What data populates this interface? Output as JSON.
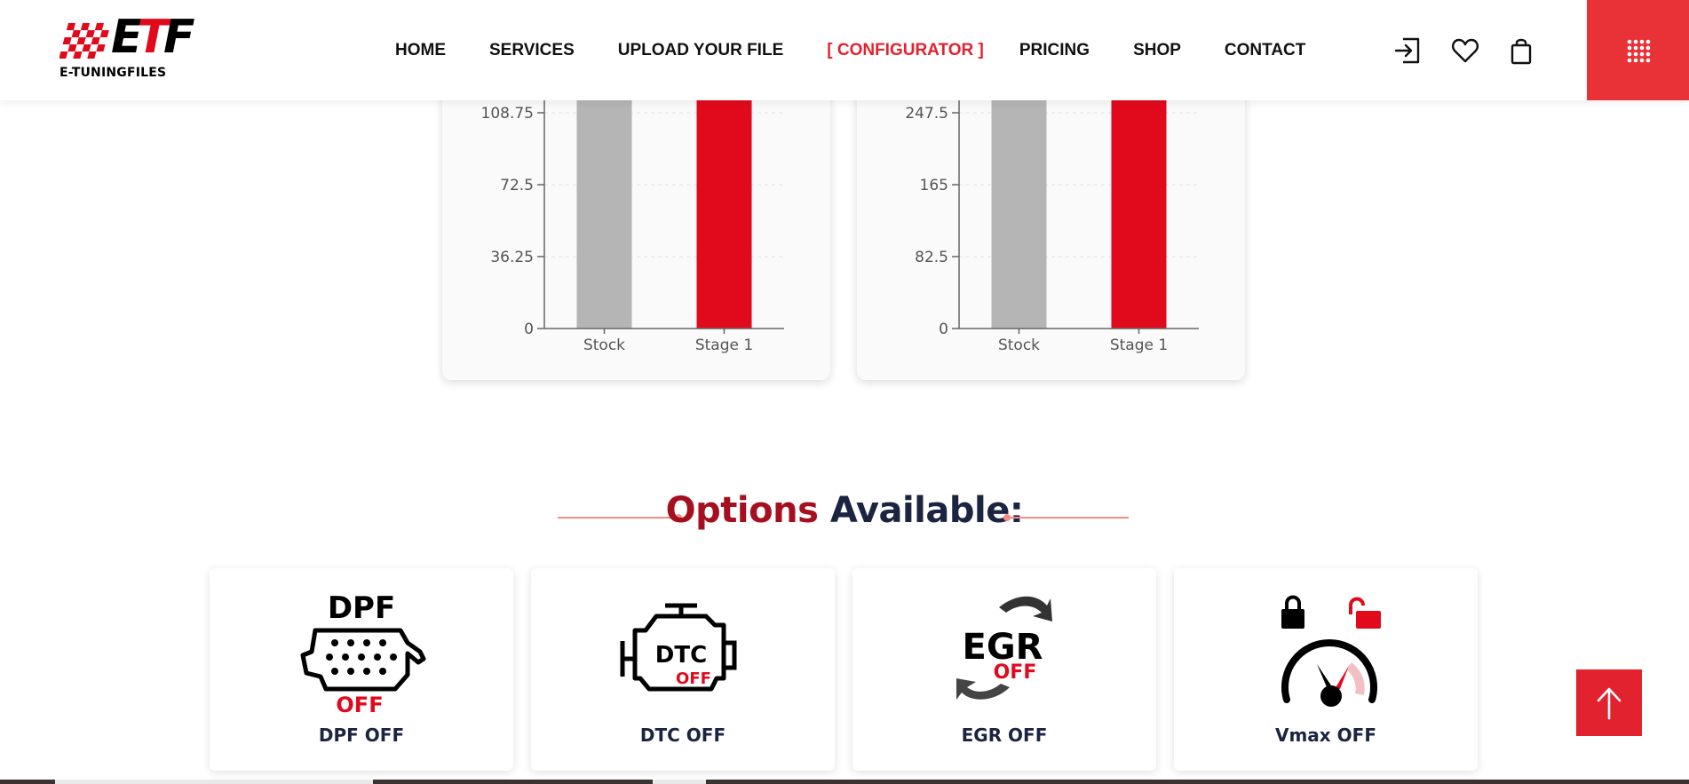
{
  "brand": {
    "logo_letters_a": "E",
    "logo_letters_b": "T",
    "logo_letters_c": "F",
    "logo_text": "E-TUNINGFILES",
    "colors": {
      "accent": "#e3222f",
      "stage1": "#e10a1d",
      "stock": "#b6b5b6",
      "navy": "#1b2440"
    }
  },
  "nav": {
    "items": [
      "HOME",
      "SERVICES",
      "UPLOAD YOUR FILE",
      "[ CONFIGURATOR ]",
      "PRICING",
      "SHOP",
      "CONTACT"
    ],
    "active_index": 3
  },
  "header_icons": [
    "login-icon",
    "heart-icon",
    "shopping-bag-icon",
    "grid-menu-icon"
  ],
  "chart_data": [
    {
      "type": "bar",
      "categories": [
        "Stock",
        "Stage 1"
      ],
      "yticks": [
        "0",
        "36.25",
        "72.5",
        "108.75"
      ],
      "ylim": [
        0,
        145
      ],
      "values": [
        145,
        145
      ],
      "note_visible": "bars extend above the visible area",
      "grid": true
    },
    {
      "type": "bar",
      "categories": [
        "Stock",
        "Stage 1"
      ],
      "yticks": [
        "0",
        "82.5",
        "165",
        "247.5"
      ],
      "ylim": [
        0,
        330
      ],
      "values": [
        330,
        330
      ],
      "note_visible": "bars extend above the visible area",
      "grid": true
    }
  ],
  "options": {
    "title_part1": "Options",
    "title_part2": "Available:",
    "items": [
      {
        "label": "DPF OFF",
        "icon_text": "DPF",
        "icon_sub": "OFF"
      },
      {
        "label": "DTC OFF",
        "icon_text": "DTC",
        "icon_sub": "OFF"
      },
      {
        "label": "EGR OFF",
        "icon_text": "EGR",
        "icon_sub": "OFF"
      },
      {
        "label": "Vmax OFF"
      }
    ]
  },
  "scroll_top_icon": "arrow-up-icon"
}
